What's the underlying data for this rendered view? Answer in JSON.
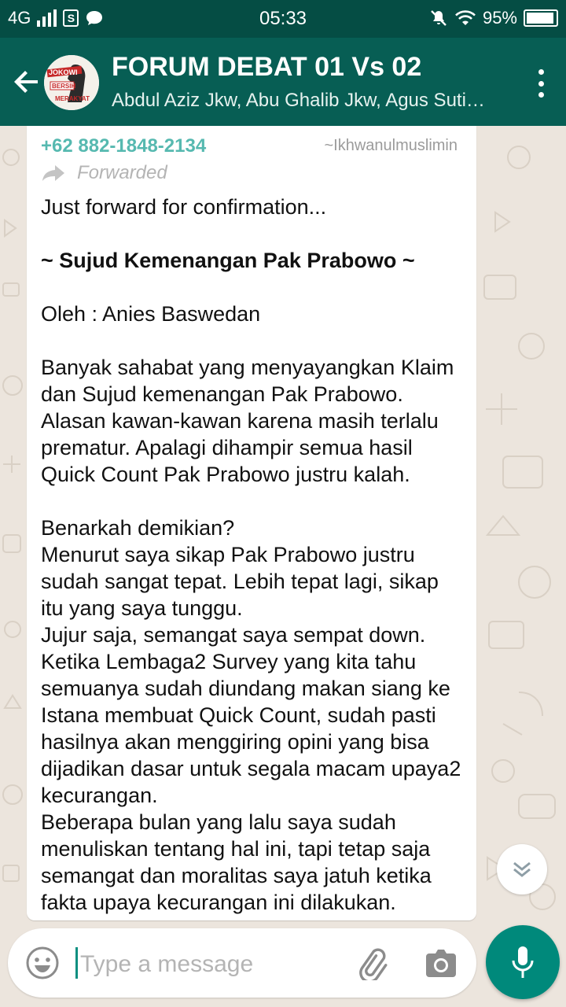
{
  "status_bar": {
    "network": "4G",
    "sim_icon": "S",
    "time": "05:33",
    "battery_percent": "95%",
    "icons": [
      "signal-icon",
      "sim-icon",
      "chat-bubble-icon",
      "mute-icon",
      "wifi-icon",
      "battery-icon"
    ]
  },
  "header": {
    "title": "FORUM DEBAT 01 Vs 02",
    "subtitle": "Abdul Aziz Jkw, Abu Ghalib Jkw, Agus Suti…",
    "avatar_text": [
      "JOKOWI",
      "BERSIH",
      "MERAKYAT"
    ]
  },
  "message": {
    "sender_phone": "+62 882-1848-2134",
    "sender_name": "~Ikhwanulmuslimin",
    "forwarded_label": "Forwarded",
    "line_intro": "Just forward for confirmation...",
    "headline": "~ Sujud Kemenangan Pak Prabowo ~",
    "author": "Oleh : Anies Baswedan",
    "paragraph_1": "Banyak sahabat yang menyayangkan Klaim dan Sujud kemenangan Pak Prabowo. Alasan kawan-kawan karena masih terlalu prematur. Apalagi dihampir semua hasil Quick Count Pak Prabowo justru kalah.",
    "paragraph_2": "Benarkah demikian?\nMenurut saya sikap Pak Prabowo justru sudah sangat tepat. Lebih tepat lagi, sikap itu yang saya tunggu.\nJujur saja, semangat saya sempat down. Ketika Lembaga2 Survey yang kita tahu semuanya sudah diundang makan siang ke Istana membuat Quick Count, sudah pasti hasilnya akan menggiring opini yang bisa dijadikan dasar untuk segala macam upaya2 kecurangan.\nBeberapa bulan yang lalu saya sudah menuliskan tentang hal ini, tapi tetap saja semangat dan moralitas saya jatuh ketika fakta upaya kecurangan ini dilakukan."
  },
  "composer": {
    "placeholder": "Type a message"
  },
  "colors": {
    "status_bar": "#054d44",
    "app_bar": "#075e54",
    "accent": "#00897b",
    "sender": "#56b9b0",
    "chat_bg": "#ece5dd"
  }
}
